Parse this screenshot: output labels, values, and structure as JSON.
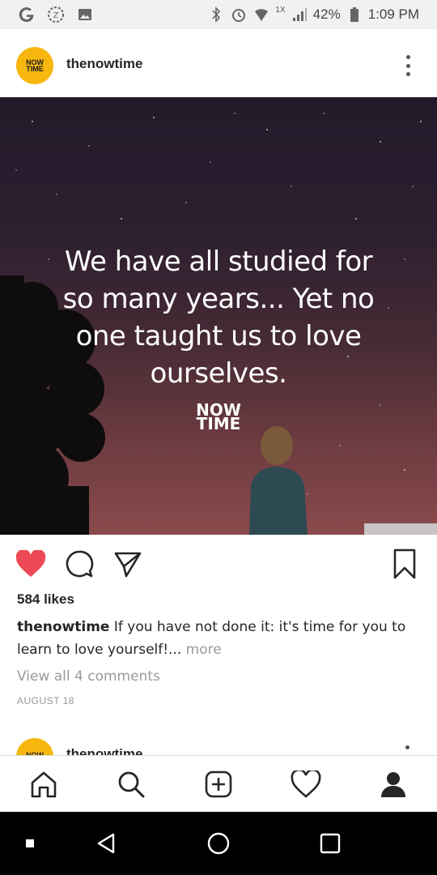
{
  "status_bar": {
    "network": "1X",
    "battery": "42%",
    "time": "1:09 PM"
  },
  "post": {
    "avatar_text": [
      "NOW",
      "TIME"
    ],
    "username": "thenowtime",
    "image": {
      "quote": "We have all studied for so many years... Yet no one taught us to love ourselves.",
      "logo_lines": [
        "NOW",
        "TIME"
      ]
    },
    "likes": "584 likes",
    "caption_user": "thenowtime",
    "caption_text": "If you have not done it: it's time for you to learn to love yourself!...",
    "caption_more": " more",
    "view_comments": "View all 4 comments",
    "date": "AUGUST 18",
    "liked": true
  },
  "next_post": {
    "avatar_text": "NOW",
    "username": "thenowtime"
  },
  "colors": {
    "like_red": "#ed4956",
    "brand_yellow": "#f7b70f",
    "muted": "#999999"
  },
  "icons": {
    "status_left": [
      "google-icon",
      "badge-icon",
      "gallery-icon"
    ],
    "status_right": [
      "bluetooth-icon",
      "alarm-icon",
      "signal-icon",
      "battery-icon"
    ],
    "actions": [
      "heart-icon",
      "comment-icon",
      "share-icon",
      "bookmark-icon"
    ],
    "bottom_nav": [
      "home-icon",
      "search-icon",
      "add-icon",
      "activity-icon",
      "profile-icon"
    ],
    "system_nav": [
      "square-dot-icon",
      "back-icon",
      "home-circle-icon",
      "recents-icon"
    ]
  }
}
